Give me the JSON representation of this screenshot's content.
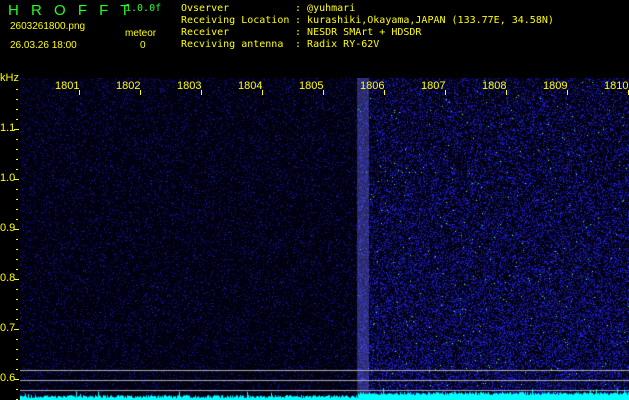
{
  "header": {
    "title": "H R O F F T",
    "version": "1.0.0f",
    "filename": "2603261800.png",
    "datetime": "26.03.26 18:00",
    "meteor_label": "meteor",
    "meteor_count": "0"
  },
  "info": [
    {
      "label": "Ovserver",
      "value": "@yuhmari"
    },
    {
      "label": "Receiving Location",
      "value": "kurashiki,Okayama,JAPAN (133.77E, 34.58N)"
    },
    {
      "label": "Receiver",
      "value": "NESDR SMArt + HDSDR"
    },
    {
      "label": "Recviving antenna",
      "value": "Radix RY-62V"
    }
  ],
  "axis": {
    "unit": "kHz",
    "freq_labels": [
      "1801",
      "1802",
      "1803",
      "1804",
      "1805",
      "1806",
      "1807",
      "1808",
      "1809",
      "1810"
    ],
    "khz_labels": [
      "1.1",
      "1.0",
      "0.9",
      "0.8",
      "0.7",
      "0.6"
    ]
  },
  "colors": {
    "noise": "#1a1aff",
    "signal": "#00ffff",
    "text": "#ffff00"
  }
}
